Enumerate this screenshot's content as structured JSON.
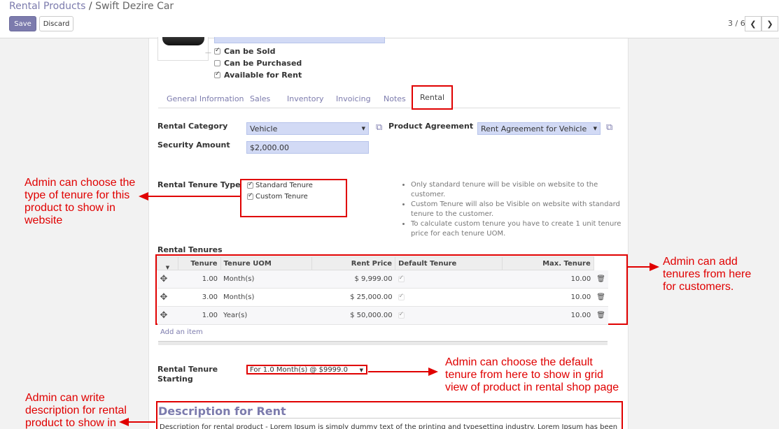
{
  "breadcrumb": {
    "parent": "Rental Products",
    "separator": "/",
    "current": "Swift Dezire Car"
  },
  "toolbar": {
    "save_label": "Save",
    "discard_label": "Discard"
  },
  "pager": {
    "text": "3 / 6",
    "prev_icon": "chevron-left-icon",
    "next_icon": "chevron-right-icon"
  },
  "product": {
    "checkboxes": [
      {
        "label": "Can be Sold",
        "checked": true
      },
      {
        "label": "Can be Purchased",
        "checked": false
      },
      {
        "label": "Available for Rent",
        "checked": true
      }
    ]
  },
  "tabs": [
    {
      "label": "General Information",
      "active": false
    },
    {
      "label": "Sales",
      "active": false
    },
    {
      "label": "Inventory",
      "active": false
    },
    {
      "label": "Invoicing",
      "active": false
    },
    {
      "label": "Notes",
      "active": false
    },
    {
      "label": "Rental",
      "active": true
    }
  ],
  "rental": {
    "category_label": "Rental Category",
    "category_value": "Vehicle",
    "agreement_label": "Product Agreement",
    "agreement_value": "Rent Agreement for Vehicle",
    "security_label": "Security Amount",
    "security_value": "$2,000.00",
    "tenure_type_label": "Rental Tenure Type",
    "tenure_types": [
      {
        "label": "Standard Tenure",
        "checked": true
      },
      {
        "label": "Custom Tenure",
        "checked": true
      }
    ],
    "notes": [
      "Only standard tenure will be visible on website to the customer.",
      "Custom Tenure will also be Visible on website with standard tenure to the customer.",
      "To calculate custom tenure you have to create 1 unit tenure price for each tenure UOM."
    ],
    "tenures_label": "Rental Tenures",
    "columns": [
      "Tenure",
      "Tenure UOM",
      "Rent Price",
      "Default Tenure",
      "Max. Tenure"
    ],
    "rows": [
      {
        "tenure": "1.00",
        "uom": "Month(s)",
        "price": "$ 9,999.00",
        "default": true,
        "max": "10.00"
      },
      {
        "tenure": "3.00",
        "uom": "Month(s)",
        "price": "$ 25,000.00",
        "default": true,
        "max": "10.00"
      },
      {
        "tenure": "1.00",
        "uom": "Year(s)",
        "price": "$ 50,000.00",
        "default": true,
        "max": "10.00"
      }
    ],
    "add_item": "Add an item",
    "starting_label_1": "Rental Tenure",
    "starting_label_2": "Starting",
    "starting_value": "For 1.0 Month(s) @ $9999.0",
    "description_title": "Description for Rent",
    "description_text": "Description for rental product - Lorem Ipsum is simply dummy text of the printing and typesetting industry. Lorem Ipsum has been the industry"
  },
  "annotations": {
    "tenure_type": [
      "Admin can choose the",
      "type of tenure for this",
      "product to show in",
      "website"
    ],
    "tenures": [
      "Admin can add",
      "tenures from here",
      "for customers."
    ],
    "default_tenure": [
      "Admin can choose the default",
      "tenure from here to show in grid",
      "view of product in rental shop page"
    ],
    "description": [
      "Admin can write",
      "description for rental",
      "product to show in"
    ]
  },
  "colors": {
    "accent": "#7c7bad",
    "highlight": "#e00000",
    "input_bg": "#d2daf5"
  }
}
